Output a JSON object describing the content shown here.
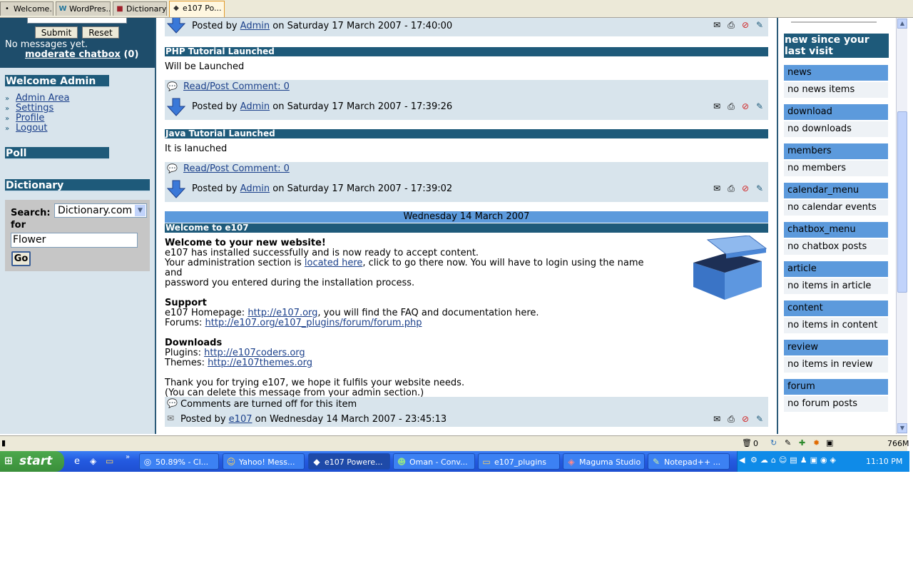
{
  "tabs": [
    {
      "label": "Welcome...",
      "icon": "•"
    },
    {
      "label": "WordPres...",
      "icon": "W"
    },
    {
      "label": "Dictionary...",
      "icon": "■"
    },
    {
      "label": "e107 Po...",
      "icon": "◆"
    }
  ],
  "left": {
    "submit_label": "Submit",
    "reset_label": "Reset",
    "no_messages": "No messages yet.",
    "moderate_link": "moderate chatbox",
    "moderate_count": "(0)",
    "welcome_title": "Welcome Admin",
    "admin_links": [
      "Admin Area",
      "Settings",
      "Profile",
      "Logout"
    ],
    "poll_title": "Poll",
    "dictionary_title": "Dictionary",
    "search_label": "Search:",
    "for_label": "for",
    "dictionary_select": "Dictionary.com",
    "search_value": "Flower",
    "go_label": "Go"
  },
  "posts": [
    {
      "posted_by": "Posted by",
      "author": "Admin",
      "date": "on Saturday 17 March 2007 - 17:40:00"
    },
    {
      "title": "PHP Tutorial Launched",
      "body": "Will be Launched",
      "comment_link": "Read/Post Comment: 0",
      "posted_by": "Posted by",
      "author": "Admin",
      "date": "on Saturday 17 March 2007 - 17:39:26"
    },
    {
      "title": "Java Tutorial Launched",
      "body": "It is lanuched",
      "comment_link": "Read/Post Comment: 0",
      "posted_by": "Posted by",
      "author": "Admin",
      "date": "on Saturday 17 March 2007 - 17:39:02"
    }
  ],
  "date_bar": "Wednesday 14 March 2007",
  "welcome": {
    "title": "Welcome to e107",
    "heading": "Welcome to your new website!",
    "line1": "e107 has installed successfully and is now ready to accept content.",
    "line2_a": "Your administration section is ",
    "line2_link": "located here",
    "line2_b": ", click to go there now. You will have to login using the name and",
    "line3": "password you entered during the installation process.",
    "support_head": "Support",
    "homepage_a": "e107 Homepage: ",
    "homepage_link": "http://e107.org",
    "homepage_b": ", you will find the FAQ and documentation here.",
    "forums_a": "Forums: ",
    "forums_link": "http://e107.org/e107_plugins/forum/forum.php",
    "downloads_head": "Downloads",
    "plugins_a": "Plugins: ",
    "plugins_link": "http://e107coders.org",
    "themes_a": "Themes: ",
    "themes_link": "http://e107themes.org",
    "thanks1": "Thank you for trying e107, we hope it fulfils your website needs.",
    "thanks2": "(You can delete this message from your admin section.)",
    "comments_off": "Comments are turned off for this item",
    "posted_by": "Posted by",
    "author": "e107",
    "date": "on Wednesday 14 March 2007 - 23:45:13"
  },
  "right": {
    "title": "new since your last visit",
    "categories": [
      {
        "name": "news",
        "value": "no news items"
      },
      {
        "name": "download",
        "value": "no downloads"
      },
      {
        "name": "members",
        "value": "no members"
      },
      {
        "name": "calendar_menu",
        "value": "no calendar events"
      },
      {
        "name": "chatbox_menu",
        "value": "no chatbox posts"
      },
      {
        "name": "article",
        "value": "no items in article"
      },
      {
        "name": "content",
        "value": "no items in content"
      },
      {
        "name": "review",
        "value": "no items in review"
      },
      {
        "name": "forum",
        "value": "no forum posts"
      }
    ]
  },
  "status": {
    "trash_count": "0",
    "memory": "766M"
  },
  "taskbar": {
    "start": "start",
    "tasks": [
      "50.89% - Cl...",
      "Yahoo! Mess...",
      "e107 Powere...",
      "Oman - Conv...",
      "e107_plugins",
      "Maguma Studio",
      "Notepad++ ..."
    ],
    "clock": "11:10 PM"
  },
  "colors": {
    "header_dark": "#1e5a7a",
    "category_blue": "#5c9adc",
    "side_bg": "#d8e4ec",
    "taskbar": "#245ae0"
  }
}
